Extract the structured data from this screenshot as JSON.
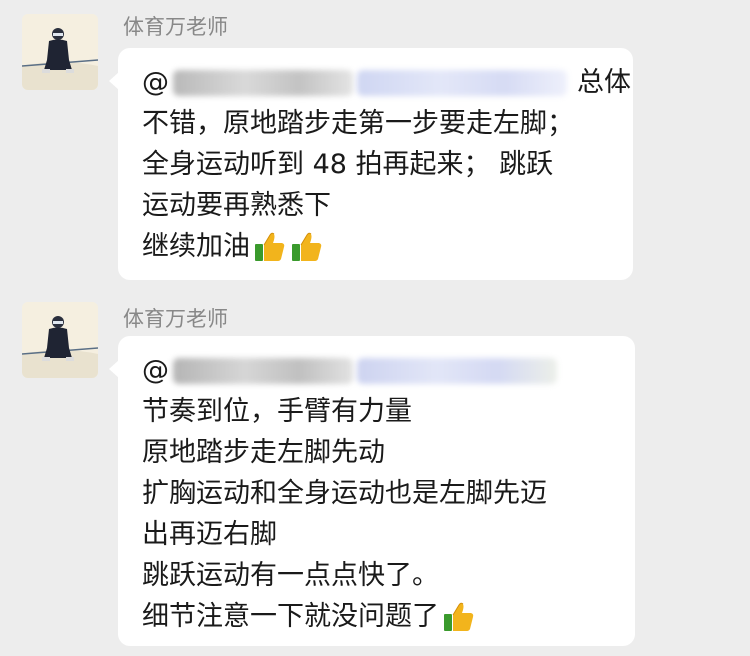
{
  "messages": [
    {
      "sender": "体育万老师",
      "mention_prefix": "@",
      "lines": [
        "总体",
        "不错，原地踏步走第一步要走左脚；",
        "全身运动听到 48 拍再起来；  跳跃",
        "运动要再熟悉下",
        "继续加油"
      ],
      "emoji": [
        "thumbs-up",
        "thumbs-up"
      ]
    },
    {
      "sender": "体育万老师",
      "mention_prefix": "@",
      "lines": [
        "节奏到位，手臂有力量",
        "原地踏步走左脚先动",
        "扩胸运动和全身运动也是左脚先迈",
        "出再迈右脚",
        "跳跃运动有一点点快了。",
        "细节注意一下就没问题了"
      ],
      "emoji": [
        "thumbs-up"
      ]
    }
  ],
  "colors": {
    "background": "#ededed",
    "bubble": "#ffffff",
    "sender_name": "#888888",
    "text": "#1a1a1a"
  }
}
